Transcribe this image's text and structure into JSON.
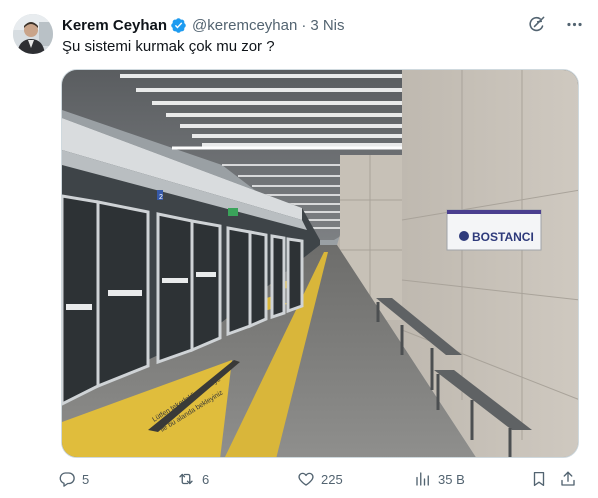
{
  "user": {
    "name": "Kerem Ceyhan",
    "handle": "@keremceyhan",
    "separator": "·",
    "date": "3 Nis"
  },
  "tweet": {
    "text": "Şu sistemi kurmak çok mu zor ?"
  },
  "photo": {
    "station_sign": "BOSTANCI",
    "platform_sign_number": "2",
    "floor_text_line1": "Lütfen tekerlekli sandalye",
    "floor_text_line2": "ile bu alanda bekleyiniz"
  },
  "actions": {
    "replies": "5",
    "reposts": "6",
    "likes": "225",
    "views": "35 B"
  },
  "icons": {
    "verified": "verified-badge-icon",
    "grok": "grok-icon",
    "more": "more-icon",
    "reply": "reply-icon",
    "repost": "repost-icon",
    "like": "heart-icon",
    "views": "views-icon",
    "bookmark": "bookmark-icon",
    "share": "share-icon"
  },
  "colors": {
    "verified": "#1d9bf0",
    "muted": "#536471",
    "text": "#0f1419"
  }
}
